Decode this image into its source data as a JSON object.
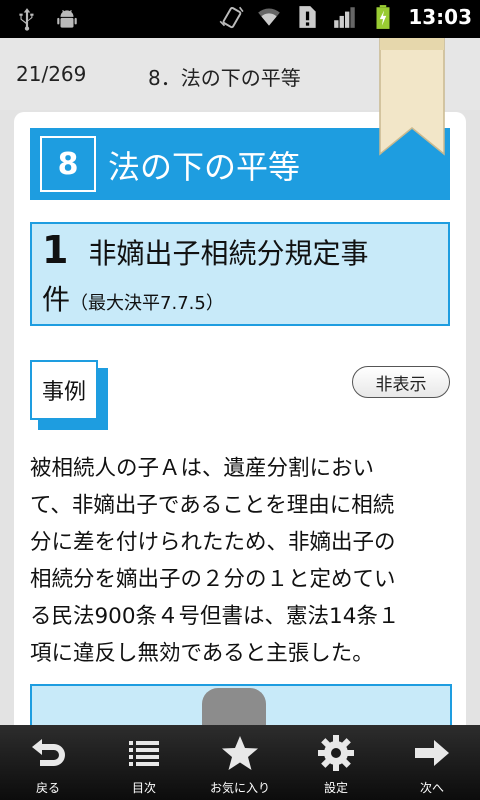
{
  "status_bar": {
    "clock": "13:03",
    "left_icons": [
      "usb-icon",
      "android-debug-icon"
    ],
    "right_icons": [
      "vibrate-icon",
      "wifi-icon",
      "alert-icon",
      "signal-icon",
      "battery-charging-icon"
    ]
  },
  "header": {
    "page_counter": "21/269",
    "chapter_title": "8．法の下の平等"
  },
  "chapter": {
    "number": "8",
    "title": "法の下の平等"
  },
  "case": {
    "number": "1",
    "title_line1": "非嫡出子相続分規定事",
    "title_line2": "件",
    "citation": "（最大決平7.7.5）"
  },
  "section_tag": "事例",
  "hide_button_label": "非表示",
  "body_lines": [
    "被相続人の子Ａは、遺産分割におい",
    "て、非嫡出子であることを理由に相続",
    "分に差を付けられたため、非嫡出子の",
    "相続分を嫡出子の２分の１と定めてい",
    "る民法900条４号但書は、憲法14条１",
    "項に違反し無効であると主張した。"
  ],
  "toolbar": [
    {
      "label": "戻る",
      "icon": "back-arrow-icon"
    },
    {
      "label": "目次",
      "icon": "list-icon"
    },
    {
      "label": "お気に入り",
      "icon": "star-icon"
    },
    {
      "label": "設定",
      "icon": "gear-icon"
    },
    {
      "label": "次へ",
      "icon": "forward-arrow-icon"
    }
  ],
  "colors": {
    "accent": "#1e9de0",
    "accent_light": "#c8eaf9",
    "bookmark": "#f2e6c8"
  }
}
